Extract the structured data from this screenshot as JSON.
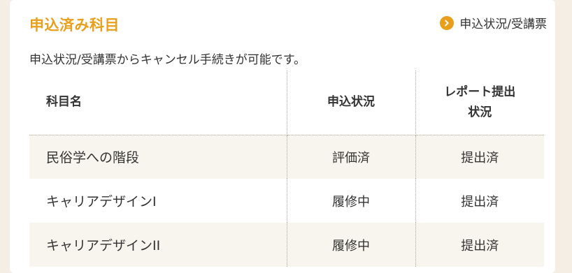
{
  "section": {
    "title": "申込済み科目",
    "status_link": "申込状況/受講票",
    "note": "申込状況/受講票からキャンセル手続きが可能です。"
  },
  "table": {
    "headers": {
      "subject": "科目名",
      "application": "申込状況",
      "report_line1": "レポート提出",
      "report_line2": "状況"
    },
    "rows": [
      {
        "subject": "民俗学への階段",
        "application": "評価済",
        "report": "提出済"
      },
      {
        "subject": "キャリアデザインI",
        "application": "履修中",
        "report": "提出済"
      },
      {
        "subject": "キャリアデザインII",
        "application": "履修中",
        "report": "提出済"
      }
    ]
  },
  "colors": {
    "accent": "#e8a01c",
    "row_alt": "#f8f5ee"
  },
  "icons": {
    "status_link": "chevron-right-circle-icon"
  }
}
